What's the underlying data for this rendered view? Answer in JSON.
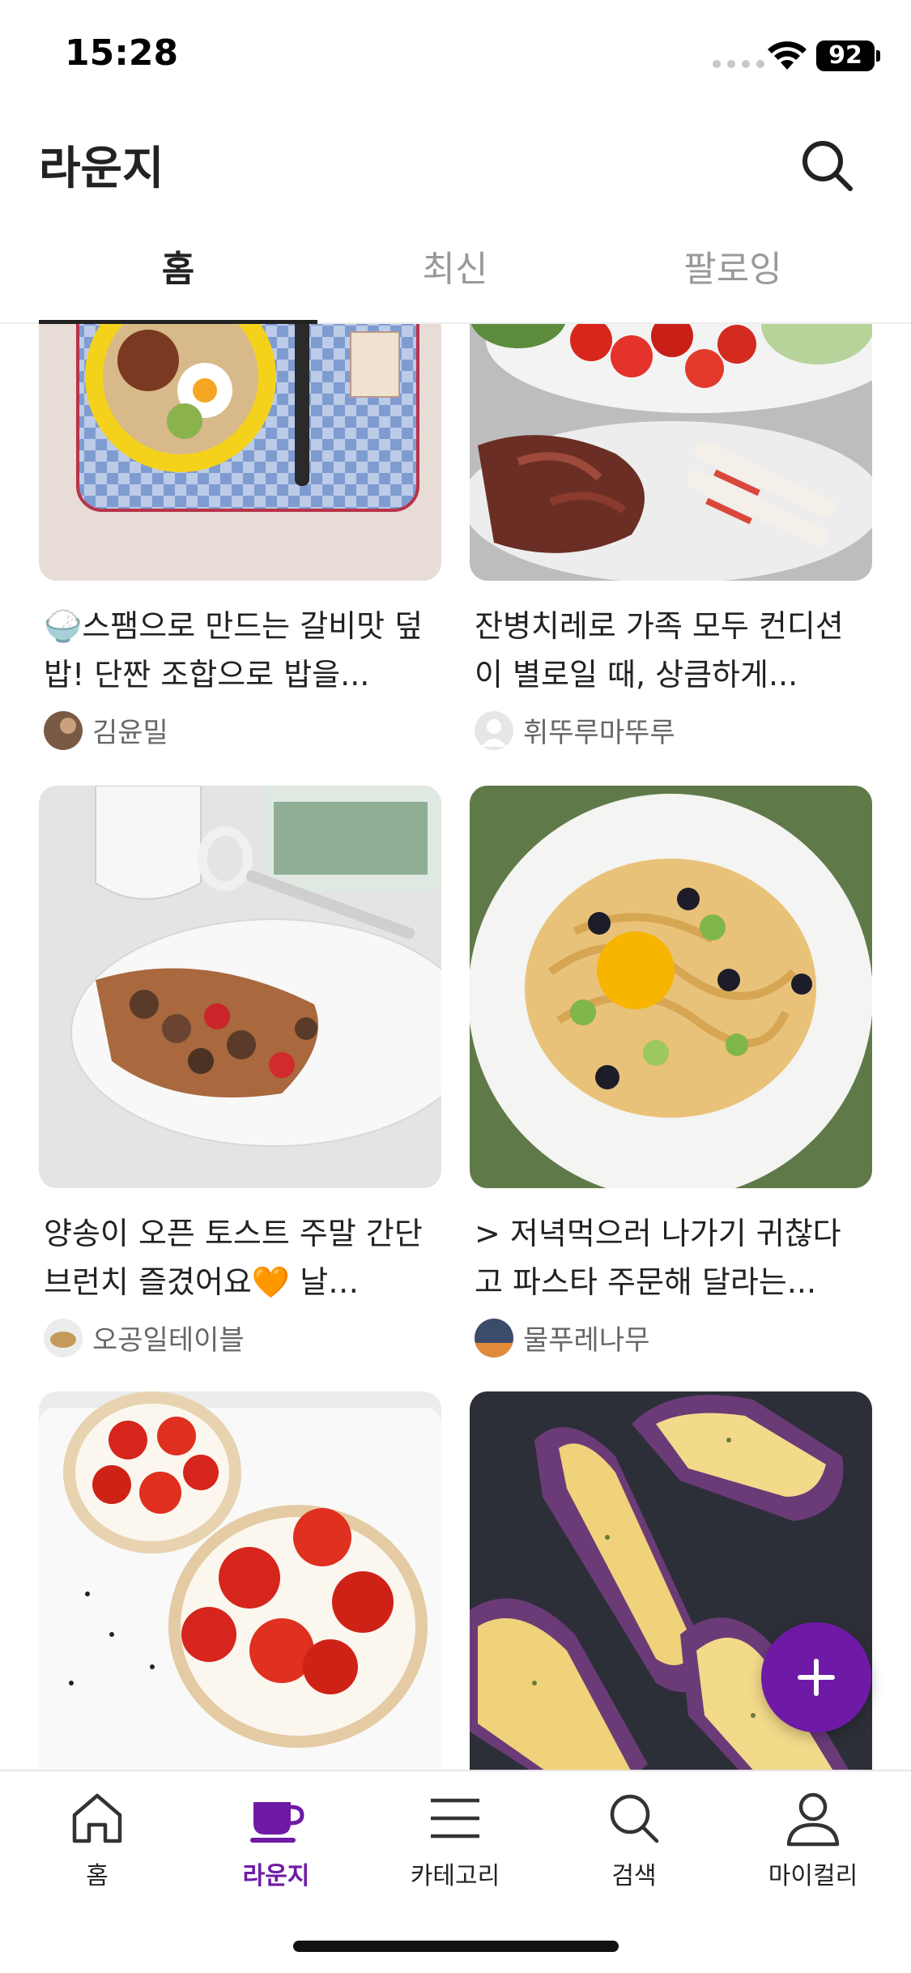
{
  "status_bar": {
    "time": "15:28",
    "battery": "92"
  },
  "header": {
    "title": "라운지"
  },
  "tabs": [
    {
      "label": "홈",
      "active": true
    },
    {
      "label": "최신",
      "active": false
    },
    {
      "label": "팔로잉",
      "active": false
    }
  ],
  "feed": {
    "cards": [
      {
        "title": "🍚스팸으로 만드는 갈비맛 덮밥!  단짠 조합으로 밥을...",
        "author": "김윤밀"
      },
      {
        "title": "잔병치레로 가족 모두 컨디션이 별로일 때, 상큼하게...",
        "author": "휘뚜루마뚜루"
      },
      {
        "title": "양송이 오픈 토스트  주말 간단 브런치 즐겼어요🧡 날…",
        "author": "오공일테이블"
      },
      {
        "title": "> 저녁먹으러 나가기 귀찮다고    파스타 주문해 달라는...",
        "author": "물푸레나무"
      },
      {
        "title": "",
        "author": ""
      },
      {
        "title": "",
        "author": ""
      }
    ]
  },
  "fab": {
    "icon": "plus-icon",
    "color": "#6f1aa6"
  },
  "bottom_nav": [
    {
      "label": "홈",
      "icon": "home-icon",
      "active": false
    },
    {
      "label": "라운지",
      "icon": "cup-icon",
      "active": true
    },
    {
      "label": "카테고리",
      "icon": "menu-icon",
      "active": false
    },
    {
      "label": "검색",
      "icon": "search-icon",
      "active": false
    },
    {
      "label": "마이컬리",
      "icon": "person-icon",
      "active": false
    }
  ],
  "colors": {
    "accent": "#6f1aa6",
    "text": "#222222",
    "muted": "#999999"
  }
}
